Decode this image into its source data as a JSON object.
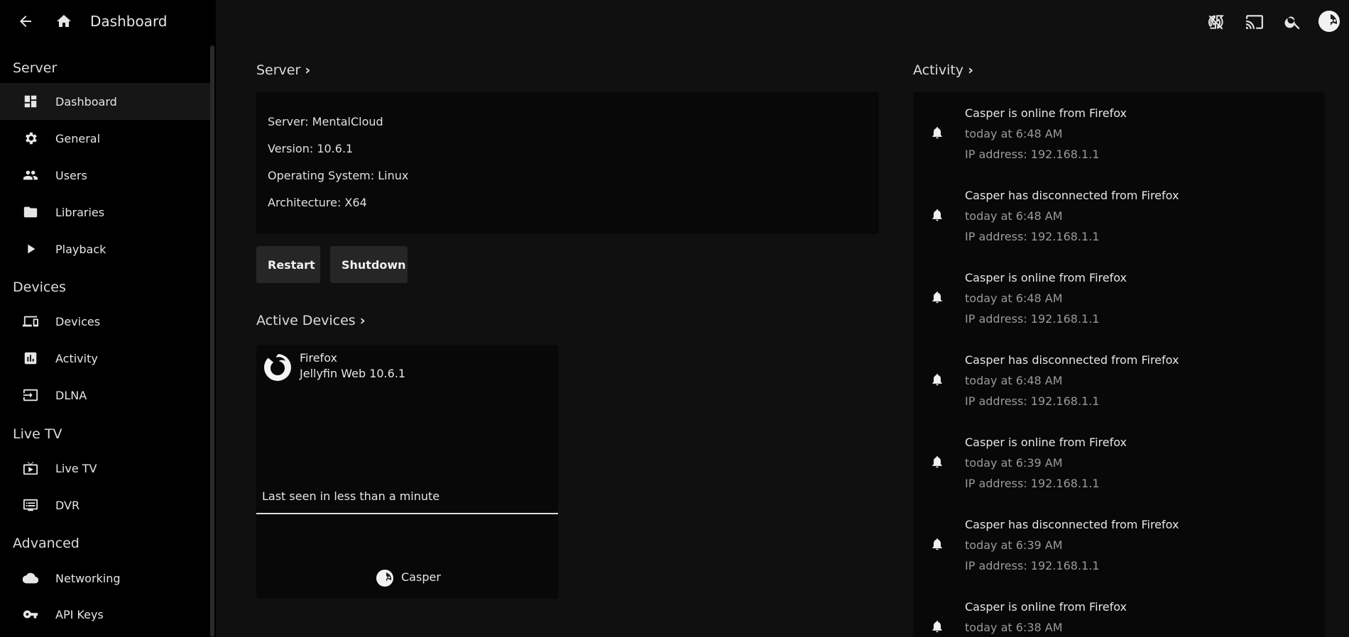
{
  "header": {
    "title": "Dashboard"
  },
  "sidebar": {
    "sections": [
      {
        "label": "Server",
        "items": [
          {
            "label": "Dashboard",
            "icon": "dashboard-icon",
            "active": true
          },
          {
            "label": "General",
            "icon": "gear-icon"
          },
          {
            "label": "Users",
            "icon": "users-icon"
          },
          {
            "label": "Libraries",
            "icon": "folder-icon"
          },
          {
            "label": "Playback",
            "icon": "play-icon"
          }
        ]
      },
      {
        "label": "Devices",
        "items": [
          {
            "label": "Devices",
            "icon": "devices-icon"
          },
          {
            "label": "Activity",
            "icon": "chart-icon"
          },
          {
            "label": "DLNA",
            "icon": "input-icon"
          }
        ]
      },
      {
        "label": "Live TV",
        "items": [
          {
            "label": "Live TV",
            "icon": "live-tv-icon"
          },
          {
            "label": "DVR",
            "icon": "dvr-icon"
          }
        ]
      },
      {
        "label": "Advanced",
        "items": [
          {
            "label": "Networking",
            "icon": "cloud-icon"
          },
          {
            "label": "API Keys",
            "icon": "key-icon"
          }
        ]
      }
    ]
  },
  "server": {
    "title": "Server",
    "lines": [
      "Server: MentalCloud",
      "Version: 10.6.1",
      "Operating System: Linux",
      "Architecture: X64"
    ],
    "restart_label": "Restart",
    "shutdown_label": "Shutdown"
  },
  "active_devices": {
    "title": "Active Devices",
    "device": {
      "name": "Firefox",
      "app": "Jellyfin Web 10.6.1",
      "last_seen": "Last seen in less than a minute",
      "user": "Casper"
    }
  },
  "activity": {
    "title": "Activity",
    "entries": [
      {
        "text": "Casper is online from Firefox",
        "time": "today at 6:48 AM",
        "ip": "IP address: 192.168.1.1"
      },
      {
        "text": "Casper has disconnected from Firefox",
        "time": "today at 6:48 AM",
        "ip": "IP address: 192.168.1.1"
      },
      {
        "text": "Casper is online from Firefox",
        "time": "today at 6:48 AM",
        "ip": "IP address: 192.168.1.1"
      },
      {
        "text": "Casper has disconnected from Firefox",
        "time": "today at 6:48 AM",
        "ip": "IP address: 192.168.1.1"
      },
      {
        "text": "Casper is online from Firefox",
        "time": "today at 6:39 AM",
        "ip": "IP address: 192.168.1.1"
      },
      {
        "text": "Casper has disconnected from Firefox",
        "time": "today at 6:39 AM",
        "ip": "IP address: 192.168.1.1"
      },
      {
        "text": "Casper is online from Firefox",
        "time": "today at 6:38 AM",
        "ip": ""
      }
    ]
  },
  "topbar": {
    "icons": [
      "sync-icon",
      "cast-icon",
      "search-icon",
      "avatar"
    ]
  }
}
